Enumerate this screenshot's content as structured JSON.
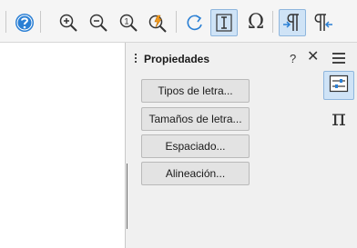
{
  "toolbar": {
    "items": [
      "help-icon",
      "zoom-in-icon",
      "zoom-out-icon",
      "zoom-100-icon",
      "zoom-pan-icon",
      "redo-icon",
      "text-cursor-icon",
      "omega-icon",
      "pilcrow-icon",
      "pilcrow-insert-icon"
    ],
    "omega_glyph": "Ω",
    "zoom_100_label": "1"
  },
  "sidebar": {
    "title": "Propiedades",
    "help_label": "?",
    "close_label": "✕",
    "buttons": [
      {
        "label": "Tipos de letra..."
      },
      {
        "label": "Tamaños de letra..."
      },
      {
        "label": "Espaciado..."
      },
      {
        "label": "Alineación..."
      }
    ]
  },
  "deck": {
    "tabs": [
      "properties-icon",
      "formula-elements-icon"
    ],
    "pi_glyph": "π"
  },
  "colors": {
    "accent": "#2a7fd4",
    "active_bg": "#cfe3f6",
    "active_border": "#8fb6dd",
    "panel_bg": "#f0f0f0"
  }
}
